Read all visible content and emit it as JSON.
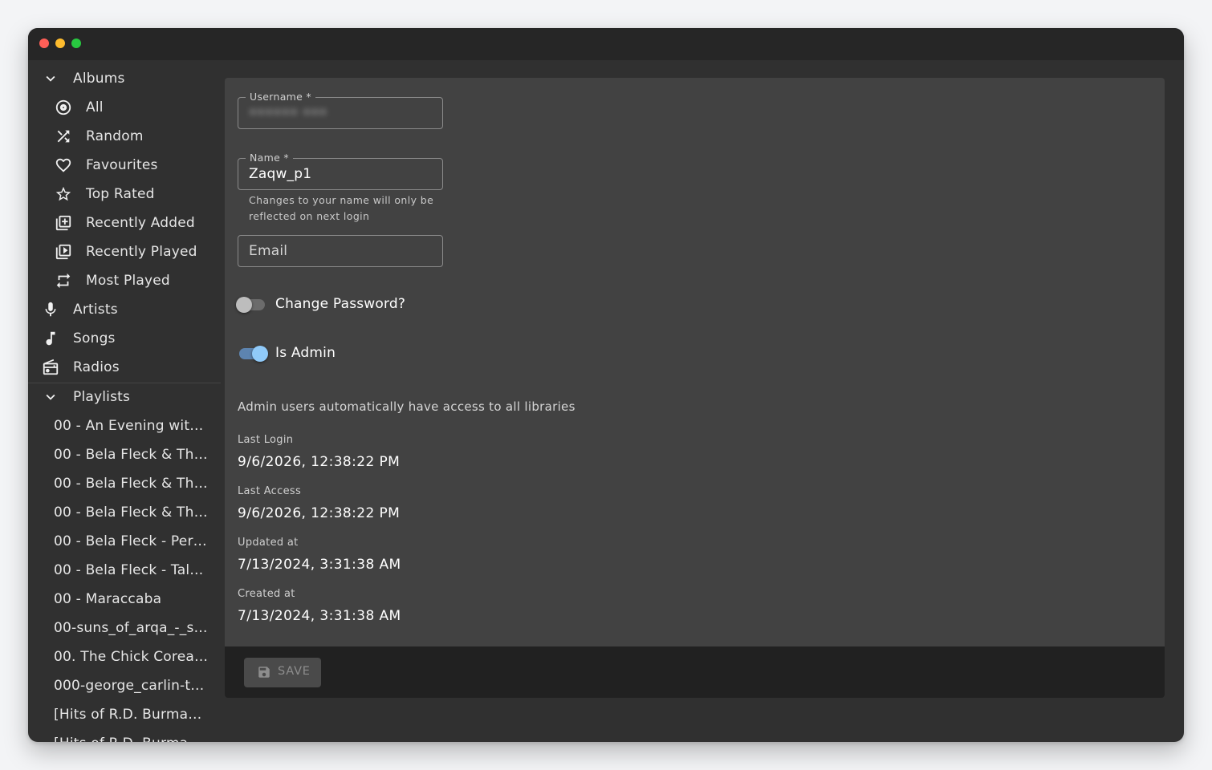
{
  "sidebar": {
    "albums_header": "Albums",
    "album_items": [
      {
        "label": "All",
        "icon": "album-icon"
      },
      {
        "label": "Random",
        "icon": "shuffle-icon"
      },
      {
        "label": "Favourites",
        "icon": "heart-icon"
      },
      {
        "label": "Top Rated",
        "icon": "star-icon"
      },
      {
        "label": "Recently Added",
        "icon": "library-add-icon"
      },
      {
        "label": "Recently Played",
        "icon": "video-library-icon"
      },
      {
        "label": "Most Played",
        "icon": "repeat-icon"
      }
    ],
    "artists_label": "Artists",
    "songs_label": "Songs",
    "radios_label": "Radios",
    "playlists_header": "Playlists",
    "playlists": [
      "00 - An Evening with ...",
      "00 - Bela Fleck & The...",
      "00 - Bela Fleck & The...",
      "00 - Bela Fleck & The...",
      "00 - Bela Fleck - Perp...",
      "00 - Bela Fleck - Tale...",
      "00 - Maraccaba",
      "00-suns_of_arqa_-_se...",
      "00. The Chick Corea ...",
      "000-george_carlin-th...",
      "[Hits of R.D. Burman]...",
      "[Hits of R.D. Burman]..."
    ]
  },
  "form": {
    "username": {
      "label": "Username *",
      "value": "•••••• •••"
    },
    "name": {
      "label": "Name *",
      "value": "Zaqw_p1",
      "helper": "Changes to your name will only be reflected on next login"
    },
    "email": {
      "placeholder": "Email"
    },
    "change_password": {
      "label": "Change Password?",
      "checked": false
    },
    "is_admin": {
      "label": "Is Admin",
      "checked": true
    },
    "admin_note": "Admin users automatically have access to all libraries",
    "last_login": {
      "label": "Last Login",
      "value": "9/6/2026, 12:38:22 PM"
    },
    "last_access": {
      "label": "Last Access",
      "value": "9/6/2026, 12:38:22 PM"
    },
    "updated_at": {
      "label": "Updated at",
      "value": "7/13/2024, 3:31:38 AM"
    },
    "created_at": {
      "label": "Created at",
      "value": "7/13/2024, 3:31:38 AM"
    }
  },
  "toolbar": {
    "save_label": "SAVE"
  },
  "colors": {
    "background": "#303030",
    "panel": "#424242",
    "toolbar": "#212121",
    "switch_on": "#90caf9"
  }
}
